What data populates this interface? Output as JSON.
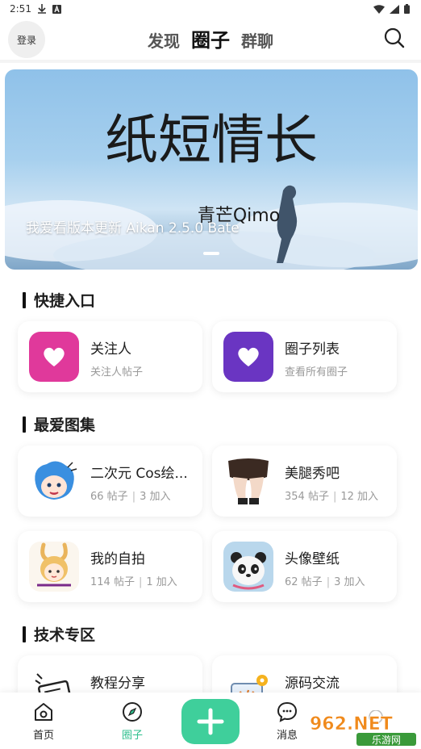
{
  "status_bar": {
    "time": "2:51"
  },
  "header": {
    "login_label": "登录",
    "tabs": [
      {
        "label": "发现"
      },
      {
        "label": "圈子"
      },
      {
        "label": "群聊"
      }
    ]
  },
  "banner": {
    "art_title": "纸短情长",
    "art_signature": "青芒Qimo",
    "caption": "我爱看版本更新 Aikan 2.5.0 Bate"
  },
  "quick_entry": {
    "title": "快捷入口",
    "items": [
      {
        "title": "关注人",
        "subtitle": "关注人帖子",
        "icon": "heart-icon",
        "color": "#e0399b"
      },
      {
        "title": "圈子列表",
        "subtitle": "查看所有圈子",
        "icon": "heart-icon",
        "color": "#6a35c2"
      }
    ]
  },
  "favorite_albums": {
    "title": "最爱图集",
    "items": [
      {
        "title": "二次元 Cos绘...",
        "posts": "66 帖子",
        "joined": "3 加入",
        "icon": "anime-avatar-icon"
      },
      {
        "title": "美腿秀吧",
        "posts": "354 帖子",
        "joined": "12 加入",
        "icon": "legs-photo-icon"
      },
      {
        "title": "我的自拍",
        "posts": "114 帖子",
        "joined": "1 加入",
        "icon": "bunny-girl-icon"
      },
      {
        "title": "头像壁纸",
        "posts": "62 帖子",
        "joined": "3 加入",
        "icon": "panda-photo-icon"
      }
    ]
  },
  "tech_zone": {
    "title": "技术专区",
    "items": [
      {
        "title": "教程分享",
        "icon": "tutorial-icon"
      },
      {
        "title": "源码交流",
        "icon": "code-icon"
      }
    ]
  },
  "bottom_nav": {
    "items": [
      {
        "label": "首页",
        "icon": "home-icon"
      },
      {
        "label": "圈子",
        "icon": "compass-icon"
      },
      {
        "label": "消息",
        "icon": "message-icon"
      }
    ],
    "accent": "#2fbf8e"
  },
  "watermark": {
    "brand": "962.NET",
    "tagline": "乐游网"
  }
}
